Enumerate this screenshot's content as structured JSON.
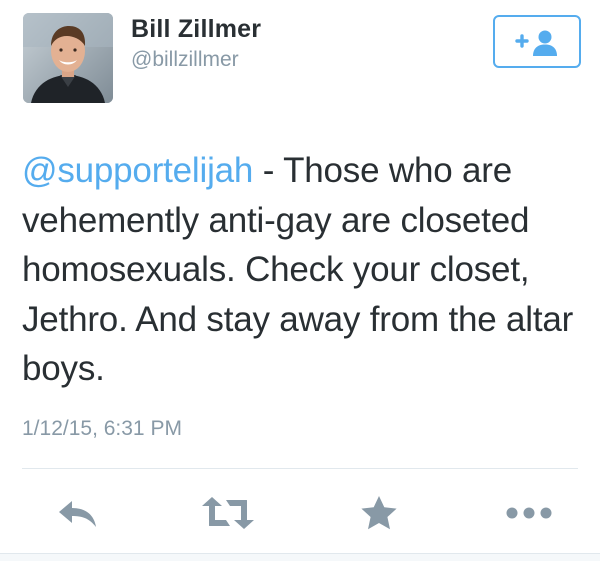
{
  "user": {
    "display_name": "Bill Zillmer",
    "handle": "@billzillmer"
  },
  "follow_button": {
    "icon": "add-user-icon",
    "color": "#55acee"
  },
  "tweet": {
    "mention": "@supportelijah",
    "text": " - Those who are vehemently anti-gay are closeted homosexuals. Check your closet, Jethro. And stay away from the altar boys.",
    "timestamp": "1/12/15, 6:31 PM"
  },
  "actions": [
    {
      "icon": "reply-icon"
    },
    {
      "icon": "retweet-icon"
    },
    {
      "icon": "favorite-star-icon"
    },
    {
      "icon": "more-options-icon"
    }
  ],
  "colors": {
    "text": "#292f33",
    "secondary": "#8899a6",
    "accent": "#55acee",
    "action_icons": "#8899a6"
  }
}
